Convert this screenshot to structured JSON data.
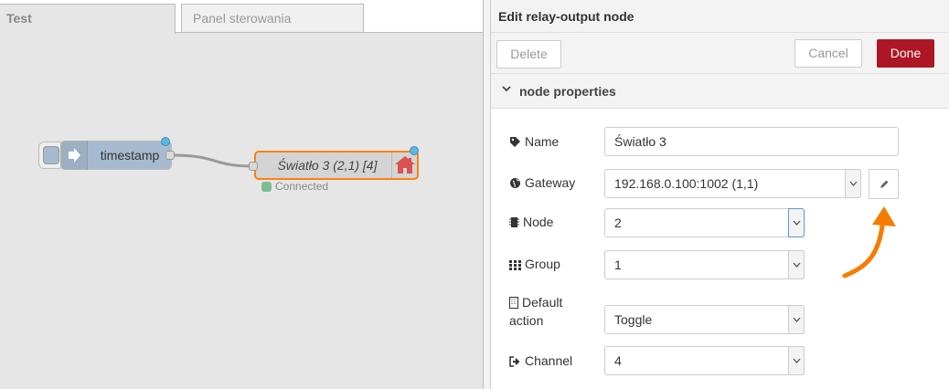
{
  "tabs": [
    {
      "label": "Test"
    },
    {
      "label": "Panel sterowania"
    }
  ],
  "flow": {
    "inject_node": {
      "label": "timestamp"
    },
    "relay_node": {
      "label": "Światło 3 (2,1) [4]",
      "status": "Connected"
    }
  },
  "tray": {
    "title": "Edit relay-output node",
    "buttons": {
      "delete": "Delete",
      "cancel": "Cancel",
      "done": "Done"
    },
    "section_title": "node properties",
    "fields": {
      "name": {
        "label": "Name",
        "value": "Światło 3"
      },
      "gateway": {
        "label": "Gateway",
        "value": "192.168.0.100:1002 (1,1)"
      },
      "node": {
        "label": "Node",
        "value": "2"
      },
      "group": {
        "label": "Group",
        "value": "1"
      },
      "default_action": {
        "label_line1": "Default",
        "label_line2": "action",
        "value": "Toggle"
      },
      "channel": {
        "label": "Channel",
        "value": "4"
      }
    }
  },
  "colors": {
    "done_button": "#ad1625",
    "selected_node_border": "#ff7f0e",
    "annotation_arrow": "#f57c00",
    "inject_node": "#a6bbcf",
    "port_dot": "#5db7e0",
    "status_connected": "#7dbb95"
  }
}
